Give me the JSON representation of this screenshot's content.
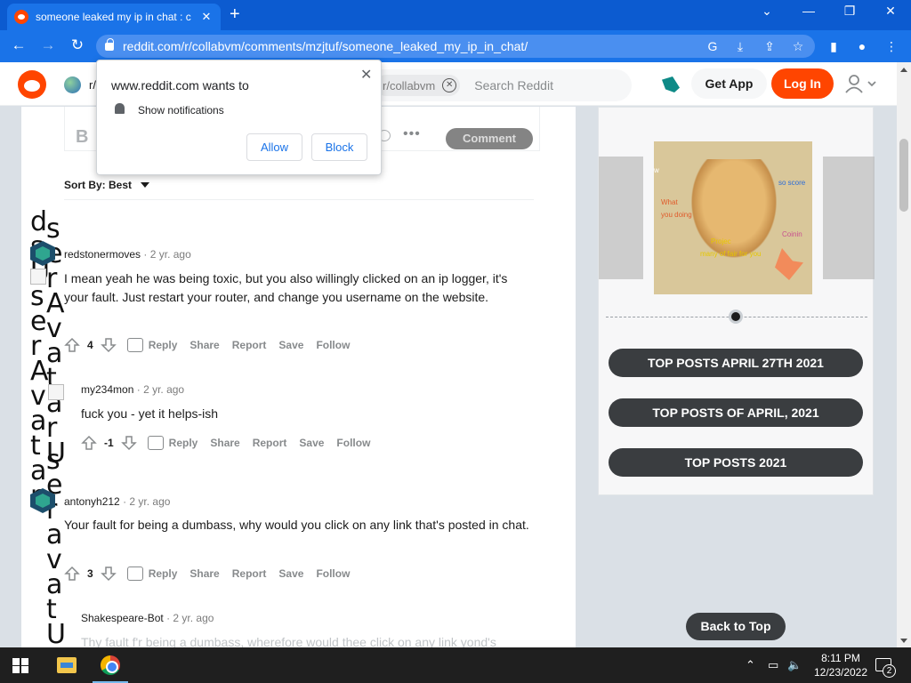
{
  "browser": {
    "tab_title": "someone leaked my ip in chat : c",
    "url": "reddit.com/r/collabvm/comments/mzjtuf/someone_leaked_my_ip_in_chat/",
    "new_tab": "+",
    "tab_close": "✕",
    "minimize": "—",
    "restore": "❐",
    "close": "✕",
    "dropdown": "⌄"
  },
  "header": {
    "subreddit_prefix": "r/",
    "search_chip": "r/collabvm",
    "search_placeholder": "Search Reddit",
    "get_app": "Get App",
    "log_in": "Log In"
  },
  "notification_prompt": {
    "title": "www.reddit.com wants to",
    "permission": "Show notifications",
    "allow": "Allow",
    "block": "Block",
    "close": "✕"
  },
  "composer": {
    "bold_label": "B",
    "more": "•••",
    "comment_button": "Comment"
  },
  "sort": {
    "label": "Sort By: Best"
  },
  "comments": [
    {
      "author": "redstonermoves",
      "age": "2 yr. ago",
      "body": "I mean yeah he was being toxic, but you also willingly clicked on an ip logger, it's your fault. Just restart your router, and change you username on the website.",
      "score": "4",
      "actions": [
        "Reply",
        "Share",
        "Report",
        "Save",
        "Follow"
      ]
    },
    {
      "author": "my234mon",
      "age": "2 yr. ago",
      "body": "fuck you - yet it helps-ish",
      "score": "-1",
      "actions": [
        "Reply",
        "Share",
        "Report",
        "Save",
        "Follow"
      ]
    },
    {
      "author": "antonyh212",
      "age": "2 yr. ago",
      "body": "Your fault for being a dumbass, why would you click on any link that's posted in chat.",
      "score": "3",
      "actions": [
        "Reply",
        "Share",
        "Report",
        "Save",
        "Follow"
      ]
    },
    {
      "author": "Shakespeare-Bot",
      "age": "2 yr. ago",
      "body": "Thy fault f'r being a dumbass, wherefore would thee click on any link yond's"
    }
  ],
  "alt_text_overlay": {
    "column_a": "dsUserAvatar",
    "column_b": "serAvatarU",
    "column_c": "serAvatarU",
    "column_d": "ser avat U"
  },
  "sidebar": {
    "meme_text": {
      "what": "What",
      "doing": "you doing",
      "score": "so score",
      "coinin": "Coinin",
      "yellow1": "Projec",
      "yellow2": "many of fair for you",
      "w": "w"
    },
    "buttons": [
      "TOP POSTS APRIL 27TH 2021",
      "TOP POSTS OF APRIL, 2021",
      "TOP POSTS 2021"
    ],
    "back_to_top": "Back to Top"
  },
  "taskbar": {
    "time": "8:11 PM",
    "date": "12/23/2022",
    "notification_count": "2",
    "tray_chevron": "⌃",
    "network": "▭",
    "volume": "🔈"
  },
  "colors": {
    "reddit_orange": "#ff4500",
    "chrome_blue": "#1a73e8",
    "dark_button": "#3a3d40"
  }
}
